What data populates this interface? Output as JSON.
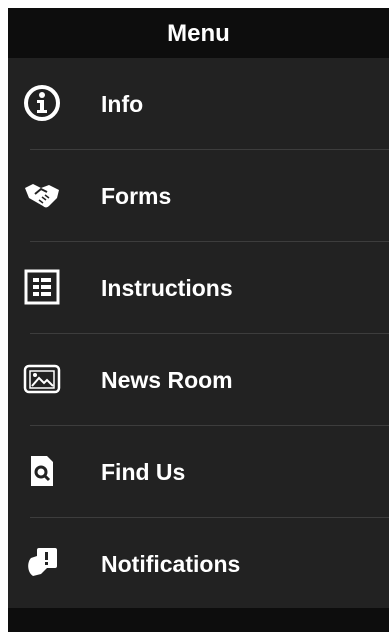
{
  "header": {
    "title": "Menu"
  },
  "menu": {
    "items": [
      {
        "label": "Info",
        "icon": "info-icon"
      },
      {
        "label": "Forms",
        "icon": "handshake-icon"
      },
      {
        "label": "Instructions",
        "icon": "list-icon"
      },
      {
        "label": "News Room",
        "icon": "image-icon"
      },
      {
        "label": "Find Us",
        "icon": "search-document-icon"
      },
      {
        "label": "Notifications",
        "icon": "notification-bell-icon"
      }
    ]
  },
  "colors": {
    "background": "#222222",
    "header": "#0d0d0d",
    "text": "#ffffff",
    "divider": "#3d3d3d"
  }
}
